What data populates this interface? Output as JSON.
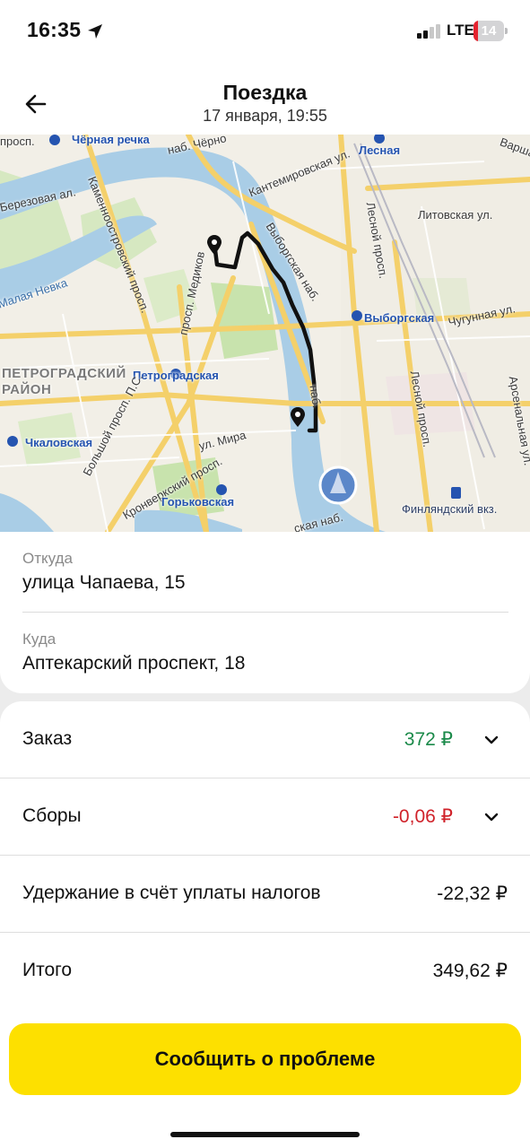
{
  "status_bar": {
    "time": "16:35",
    "network": "LTE",
    "battery": "14",
    "battery_level": 0.14,
    "icons": [
      "location-arrow-icon",
      "signal-icon",
      "battery-icon"
    ]
  },
  "header": {
    "title": "Поездка",
    "subtitle": "17 января, 19:55",
    "back_icon": "arrow-left-icon"
  },
  "map": {
    "labels": {
      "chernaya_rechka": "Чёрная речка",
      "prosp_top": "просп.",
      "nab_top": "наб. Чёрно",
      "kantemirovskaya": "Кантемировская ул.",
      "lesnaya": "Лесная",
      "varshavskaya": "Варша",
      "berezovaya": "Березовая ал.",
      "kamennoostrovsky": "Каменноостровский просп.",
      "litovskaya": "Литовская ул.",
      "malaya_nevka": "Малая Невка",
      "vyborgskaya_nab": "Выборгская наб.",
      "lesnoy": "Лесной просп.",
      "medikov": "просп. Медиков",
      "vyborgskaya": "Выборгская",
      "chugunnaya": "Чугунная ул.",
      "district": "ПЕТРОГРАДСКИЙ\nРАЙОН",
      "petrogradskaya": "Петроградская",
      "lesnoy2": "Лесной просп.",
      "arsenalnaya": "Арсенальная ул.",
      "bolshoy": "Большой просп. П.С.",
      "chkalovskaya": "Чкаловская",
      "ul_mira": "ул. Мира",
      "kronverksky": "Кронверкский просп.",
      "gorkovskaya": "Горьковская",
      "finlyandsky": "Финляндский вкз.",
      "nab_bottom": "ская наб.",
      "nab_right": "наб."
    },
    "colors": {
      "water": "#a9cde6",
      "park": "#cfe5b8",
      "road": "#f7d774",
      "route": "#111111"
    }
  },
  "trip": {
    "from_label": "Откуда",
    "from_value": "улица Чапаева, 15",
    "to_label": "Куда",
    "to_value": "Аптекарский проспект, 18"
  },
  "payment": {
    "rows": [
      {
        "label": "Заказ",
        "value": "372 ₽",
        "color": "#1b8a4a",
        "expandable": true
      },
      {
        "label": "Сборы",
        "value": "-0,06 ₽",
        "color": "#d0222a",
        "expandable": true
      },
      {
        "label": "Удержание в счёт уплаты налогов",
        "value": "-22,32 ₽",
        "color": "#111111",
        "expandable": false
      },
      {
        "label": "Итого",
        "value": "349,62 ₽",
        "color": "#111111",
        "expandable": false
      }
    ]
  },
  "action": {
    "report_label": "Сообщить о проблеме"
  }
}
